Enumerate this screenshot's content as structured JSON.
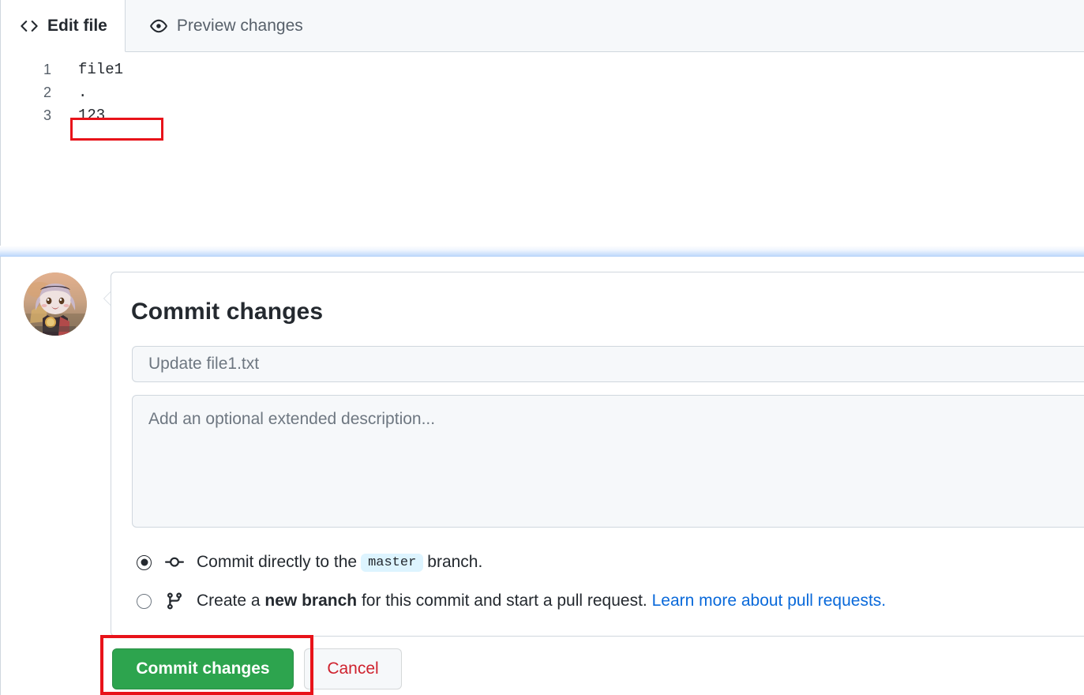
{
  "editor": {
    "tabs": [
      {
        "label": "Edit file",
        "icon": "code-icon",
        "active": true
      },
      {
        "label": "Preview changes",
        "icon": "eye-icon",
        "active": false
      }
    ],
    "code_lines": [
      {
        "number": "1",
        "text": "file1"
      },
      {
        "number": "2",
        "text": "."
      },
      {
        "number": "3",
        "text": "123"
      }
    ]
  },
  "commit": {
    "heading": "Commit changes",
    "message_placeholder": "Update file1.txt",
    "message_value": "",
    "description_placeholder": "Add an optional extended description...",
    "description_value": "",
    "options": [
      {
        "icon": "git-commit-icon",
        "selected": true,
        "text_before": "Commit directly to the",
        "badge": "master",
        "text_after": "branch."
      },
      {
        "icon": "git-branch-icon",
        "selected": false,
        "text_before": "Create a",
        "bold": "new branch",
        "text_after": "for this commit and start a pull request.",
        "link": "Learn more about pull requests."
      }
    ],
    "commit_button_label": "Commit changes",
    "cancel_button_label": "Cancel"
  },
  "colors": {
    "commit_green": "#2da44e",
    "cancel_red": "#cf222e",
    "link_blue": "#0969da",
    "annotation_red": "#e8131a",
    "badge_blue_bg": "#ddf4ff",
    "tab_bar_bg": "#f6f8fa"
  }
}
